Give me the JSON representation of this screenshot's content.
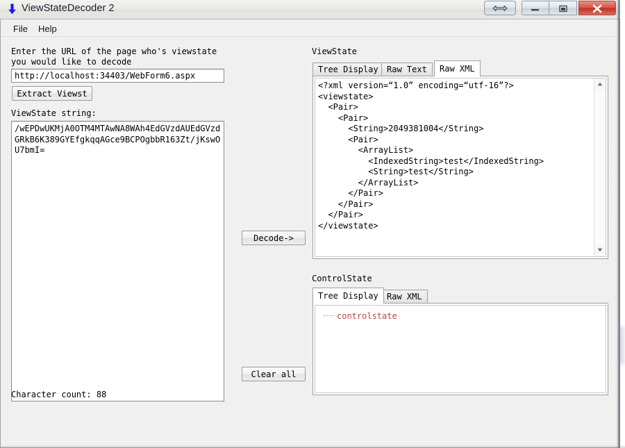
{
  "window": {
    "title": "ViewStateDecoder 2",
    "icon": "down-arrow-icon",
    "controls": {
      "resize": "resize-window-icon",
      "minimize": "minimize-icon",
      "maximize": "maximize-icon",
      "close": "close-icon"
    }
  },
  "menu": {
    "items": [
      {
        "label": "File"
      },
      {
        "label": "Help"
      }
    ]
  },
  "left": {
    "url_prompt_line1": "Enter the URL of the page who's viewstate",
    "url_prompt_line2": "you would like to decode",
    "url_value": "http://localhost:34403/WebForm6.aspx",
    "url_placeholder": "http://",
    "extract_button": "Extract Viewst",
    "viewstate_label": "ViewState string:",
    "viewstate_value": "/wEPDwUKMjA0OTM4MTAwNA8WAh4EdGVzdAUEdGVzdGRkB6K389GYEfgkqqAGce9BCPOgbbR163Zt/jKswOU7bmI=",
    "viewstate_placeholder": "",
    "character_count": "Character count: 88"
  },
  "center": {
    "decode_button": "Decode->",
    "clear_button": "Clear all"
  },
  "viewstate_panel": {
    "heading": "ViewState",
    "tabs": [
      {
        "label": "Tree Display",
        "active": false
      },
      {
        "label": "Raw Text",
        "active": false
      },
      {
        "label": "Raw XML",
        "active": true
      }
    ],
    "raw_xml": "<?xml version=“1.0” encoding=“utf-16”?>\n<viewstate>\n  <Pair>\n    <Pair>\n      <String>2049381004</String>\n      <Pair>\n        <ArrayList>\n          <IndexedString>test</IndexedString>\n          <String>test</String>\n        </ArrayList>\n      </Pair>\n    </Pair>\n  </Pair>\n</viewstate>"
  },
  "controlstate_panel": {
    "heading": "ControlState",
    "tabs": [
      {
        "label": "Tree Display",
        "active": true
      },
      {
        "label": "Raw XML",
        "active": false
      }
    ],
    "tree_root": "controlstate"
  },
  "colors": {
    "accent": "#1a1aee",
    "close_button": "#c33226",
    "tree_node": "#b04a4a",
    "window_bg": "#f0f0f0"
  }
}
